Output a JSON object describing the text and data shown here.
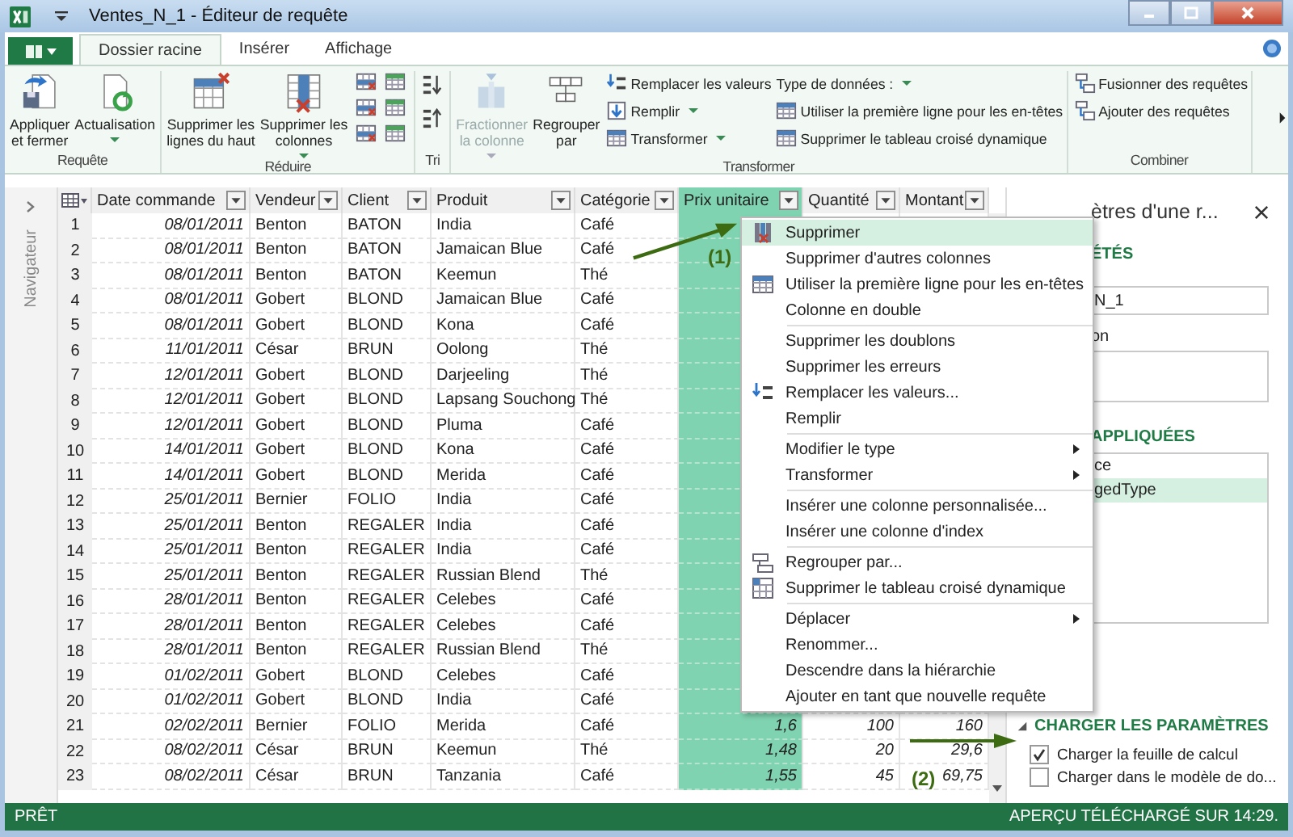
{
  "window": {
    "title": "Ventes_N_1 - Éditeur de requête"
  },
  "tabs": [
    {
      "label": "Dossier racine",
      "selected": true
    },
    {
      "label": "Insérer",
      "selected": false
    },
    {
      "label": "Affichage",
      "selected": false
    }
  ],
  "ribbon": {
    "groups": [
      {
        "label": "Requête",
        "large": [
          {
            "lines": [
              "Appliquer",
              "et fermer"
            ],
            "dropdown": false,
            "disabled": false
          },
          {
            "lines": [
              "Actualisation"
            ],
            "dropdown": true,
            "disabled": false
          }
        ]
      },
      {
        "label": "Réduire",
        "large": [
          {
            "lines": [
              "Supprimer les",
              "lignes du haut"
            ],
            "dropdown": false,
            "disabled": false
          },
          {
            "lines": [
              "Supprimer les",
              "colonnes"
            ],
            "dropdown": true,
            "disabled": false
          }
        ]
      },
      {
        "label": "Tri"
      },
      {
        "label": "Transformer",
        "large": [
          {
            "lines": [
              "Fractionner",
              "la colonne"
            ],
            "dropdown": true,
            "disabled": true
          },
          {
            "lines": [
              "Regrouper",
              "par"
            ],
            "dropdown": false,
            "disabled": false
          }
        ],
        "columns": [
          [
            {
              "label": "Remplacer les valeurs",
              "dropdown": false,
              "icon": true
            },
            {
              "label": "Remplir",
              "dropdown": true,
              "icon": true
            },
            {
              "label": "Transformer",
              "dropdown": true,
              "icon": true
            }
          ],
          [
            {
              "label": "Type de données :",
              "dropdown": true,
              "icon": false
            },
            {
              "label": "Utiliser la première ligne pour les en-têtes",
              "dropdown": false,
              "icon": true
            },
            {
              "label": "Supprimer le tableau croisé dynamique",
              "dropdown": false,
              "icon": true
            }
          ]
        ]
      },
      {
        "label": "Combiner",
        "columns": [
          [
            {
              "label": "Fusionner des requêtes",
              "dropdown": false,
              "icon": true
            },
            {
              "label": "Ajouter des requêtes",
              "dropdown": false,
              "icon": true
            }
          ]
        ]
      }
    ]
  },
  "navigator": {
    "label": "Navigateur"
  },
  "table": {
    "columns": [
      {
        "label": "Date commande",
        "kind": "date",
        "selected": false
      },
      {
        "label": "Vendeur",
        "kind": "text",
        "selected": false
      },
      {
        "label": "Client",
        "kind": "text",
        "selected": false
      },
      {
        "label": "Produit",
        "kind": "text",
        "selected": false
      },
      {
        "label": "Catégorie",
        "kind": "text",
        "selected": false
      },
      {
        "label": "Prix unitaire",
        "kind": "number",
        "selected": true
      },
      {
        "label": "Quantité",
        "kind": "number",
        "selected": false
      },
      {
        "label": "Montant",
        "kind": "number",
        "selected": false
      }
    ],
    "rows": [
      {
        "num": "1",
        "cells": [
          "08/01/2011",
          "Benton",
          "BATON",
          "India",
          "Café"
        ]
      },
      {
        "num": "2",
        "cells": [
          "08/01/2011",
          "Benton",
          "BATON",
          "Jamaican Blue",
          "Café"
        ]
      },
      {
        "num": "3",
        "cells": [
          "08/01/2011",
          "Benton",
          "BATON",
          "Keemun",
          "Thé"
        ]
      },
      {
        "num": "4",
        "cells": [
          "08/01/2011",
          "Gobert",
          "BLOND",
          "Jamaican Blue",
          "Café"
        ]
      },
      {
        "num": "5",
        "cells": [
          "08/01/2011",
          "Gobert",
          "BLOND",
          "Kona",
          "Café"
        ]
      },
      {
        "num": "6",
        "cells": [
          "11/01/2011",
          "César",
          "BRUN",
          "Oolong",
          "Thé"
        ]
      },
      {
        "num": "7",
        "cells": [
          "12/01/2011",
          "Gobert",
          "BLOND",
          "Darjeeling",
          "Thé"
        ]
      },
      {
        "num": "8",
        "cells": [
          "12/01/2011",
          "Gobert",
          "BLOND",
          "Lapsang Souchong",
          "Thé"
        ]
      },
      {
        "num": "9",
        "cells": [
          "12/01/2011",
          "Gobert",
          "BLOND",
          "Pluma",
          "Café"
        ]
      },
      {
        "num": "10",
        "cells": [
          "14/01/2011",
          "Gobert",
          "BLOND",
          "Kona",
          "Café"
        ]
      },
      {
        "num": "11",
        "cells": [
          "14/01/2011",
          "Gobert",
          "BLOND",
          "Merida",
          "Café"
        ]
      },
      {
        "num": "12",
        "cells": [
          "25/01/2011",
          "Bernier",
          "FOLIO",
          "India",
          "Café"
        ]
      },
      {
        "num": "13",
        "cells": [
          "25/01/2011",
          "Benton",
          "REGALER",
          "India",
          "Café"
        ]
      },
      {
        "num": "14",
        "cells": [
          "25/01/2011",
          "Benton",
          "REGALER",
          "India",
          "Café"
        ]
      },
      {
        "num": "15",
        "cells": [
          "25/01/2011",
          "Benton",
          "REGALER",
          "Russian Blend",
          "Thé"
        ]
      },
      {
        "num": "16",
        "cells": [
          "28/01/2011",
          "Benton",
          "REGALER",
          "Celebes",
          "Café"
        ]
      },
      {
        "num": "17",
        "cells": [
          "28/01/2011",
          "Benton",
          "REGALER",
          "Celebes",
          "Café"
        ]
      },
      {
        "num": "18",
        "cells": [
          "28/01/2011",
          "Benton",
          "REGALER",
          "Russian Blend",
          "Thé"
        ]
      },
      {
        "num": "19",
        "cells": [
          "01/02/2011",
          "Gobert",
          "BLOND",
          "Celebes",
          "Café"
        ]
      },
      {
        "num": "20",
        "cells": [
          "01/02/2011",
          "Gobert",
          "BLOND",
          "India",
          "Café"
        ]
      },
      {
        "num": "21",
        "cells": [
          "02/02/2011",
          "Bernier",
          "FOLIO",
          "Merida",
          "Café",
          "1,6",
          "100",
          "160"
        ]
      },
      {
        "num": "22",
        "cells": [
          "08/02/2011",
          "César",
          "BRUN",
          "Keemun",
          "Thé",
          "1,48",
          "20",
          "29,6"
        ]
      },
      {
        "num": "23",
        "cells": [
          "08/02/2011",
          "César",
          "BRUN",
          "Tanzania",
          "Café",
          "1,55",
          "45",
          "69,75"
        ]
      }
    ]
  },
  "context_menu": {
    "sections": [
      {
        "items": [
          {
            "label": "Supprimer",
            "selected": true,
            "submenu": false
          },
          {
            "label": "Supprimer d'autres colonnes",
            "selected": false,
            "submenu": false
          },
          {
            "label": "Utiliser la première ligne pour les en-têtes",
            "selected": false,
            "submenu": false
          },
          {
            "label": "Colonne en double",
            "selected": false,
            "submenu": false
          }
        ]
      },
      {
        "items": [
          {
            "label": "Supprimer les doublons",
            "selected": false,
            "submenu": false
          },
          {
            "label": "Supprimer les erreurs",
            "selected": false,
            "submenu": false
          },
          {
            "label": "Remplacer les valeurs...",
            "selected": false,
            "submenu": false
          },
          {
            "label": "Remplir",
            "selected": false,
            "submenu": false
          }
        ]
      },
      {
        "items": [
          {
            "label": "Modifier le type",
            "selected": false,
            "submenu": true
          },
          {
            "label": "Transformer",
            "selected": false,
            "submenu": true
          }
        ]
      },
      {
        "items": [
          {
            "label": "Insérer une colonne personnalisée...",
            "selected": false,
            "submenu": false
          },
          {
            "label": "Insérer une colonne d'index",
            "selected": false,
            "submenu": false
          }
        ]
      },
      {
        "items": [
          {
            "label": "Regrouper par...",
            "selected": false,
            "submenu": false
          },
          {
            "label": "Supprimer le tableau croisé dynamique",
            "selected": false,
            "submenu": false
          }
        ]
      },
      {
        "items": [
          {
            "label": "Déplacer",
            "selected": false,
            "submenu": true
          },
          {
            "label": "Renommer...",
            "selected": false,
            "submenu": false
          },
          {
            "label": "Descendre dans la hiérarchie",
            "selected": false,
            "submenu": false
          },
          {
            "label": "Ajouter en tant que nouvelle requête",
            "selected": false,
            "submenu": false
          }
        ]
      }
    ]
  },
  "query_settings": {
    "title": "ètres d'une r...",
    "properties_heading": "ÉTÉS",
    "name_value": "N_1",
    "description_label": "on",
    "steps_heading": "APPLIQUÉES",
    "steps": [
      {
        "label": "ce",
        "selected": false
      },
      {
        "label": "gedType",
        "selected": true
      }
    ],
    "load_heading": "CHARGER LES PARAMÈTRES",
    "load_expanded": true,
    "load_options": [
      {
        "label": "Charger la feuille de calcul",
        "checked": true
      },
      {
        "label": "Charger dans le modèle de do...",
        "checked": false
      }
    ]
  },
  "annotations": [
    {
      "label": "(1)"
    },
    {
      "label": "(2)"
    }
  ],
  "status_bar": {
    "left": "PRÊT",
    "right": "APERÇU TÉLÉCHARGÉ SUR 14:29."
  }
}
